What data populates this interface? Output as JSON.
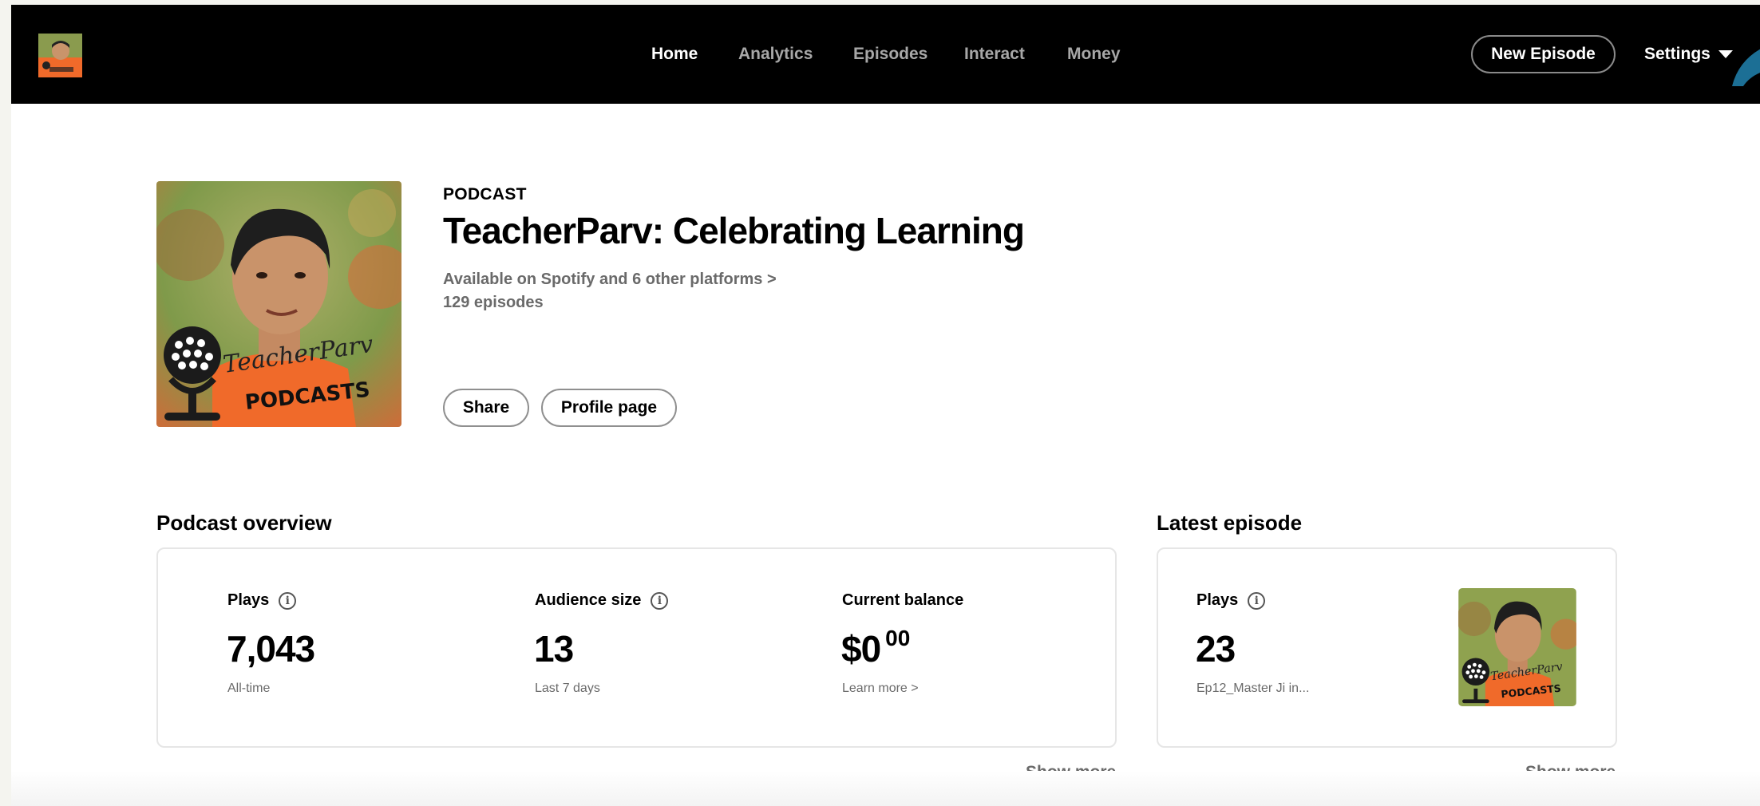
{
  "header": {
    "nav": [
      {
        "label": "Home",
        "active": true
      },
      {
        "label": "Analytics",
        "active": false
      },
      {
        "label": "Episodes",
        "active": false
      },
      {
        "label": "Interact",
        "active": false
      },
      {
        "label": "Money",
        "active": false
      }
    ],
    "new_episode_label": "New Episode",
    "settings_label": "Settings"
  },
  "podcast": {
    "kicker": "PODCAST",
    "title": "TeacherParv: Celebrating Learning",
    "availability": "Available on Spotify and 6 other platforms >",
    "episode_count": "129 episodes",
    "share_label": "Share",
    "profile_label": "Profile page",
    "cover_text_line1": "TeacherParv",
    "cover_text_line2": "PODCASTS"
  },
  "overview": {
    "title": "Podcast overview",
    "plays": {
      "label": "Plays",
      "value": "7,043",
      "sub": "All-time"
    },
    "audience": {
      "label": "Audience size",
      "value": "13",
      "sub": "Last 7 days"
    },
    "balance": {
      "label": "Current balance",
      "value": "$0",
      "cents": "00",
      "sub": "Learn more >"
    },
    "show_more": "Show more"
  },
  "latest": {
    "title": "Latest episode",
    "plays": {
      "label": "Plays",
      "value": "23",
      "sub": "Ep12_Master Ji in..."
    },
    "show_more": "Show more"
  },
  "colors": {
    "topbar": "#000000",
    "accent_swoosh": "#1c6f95"
  }
}
